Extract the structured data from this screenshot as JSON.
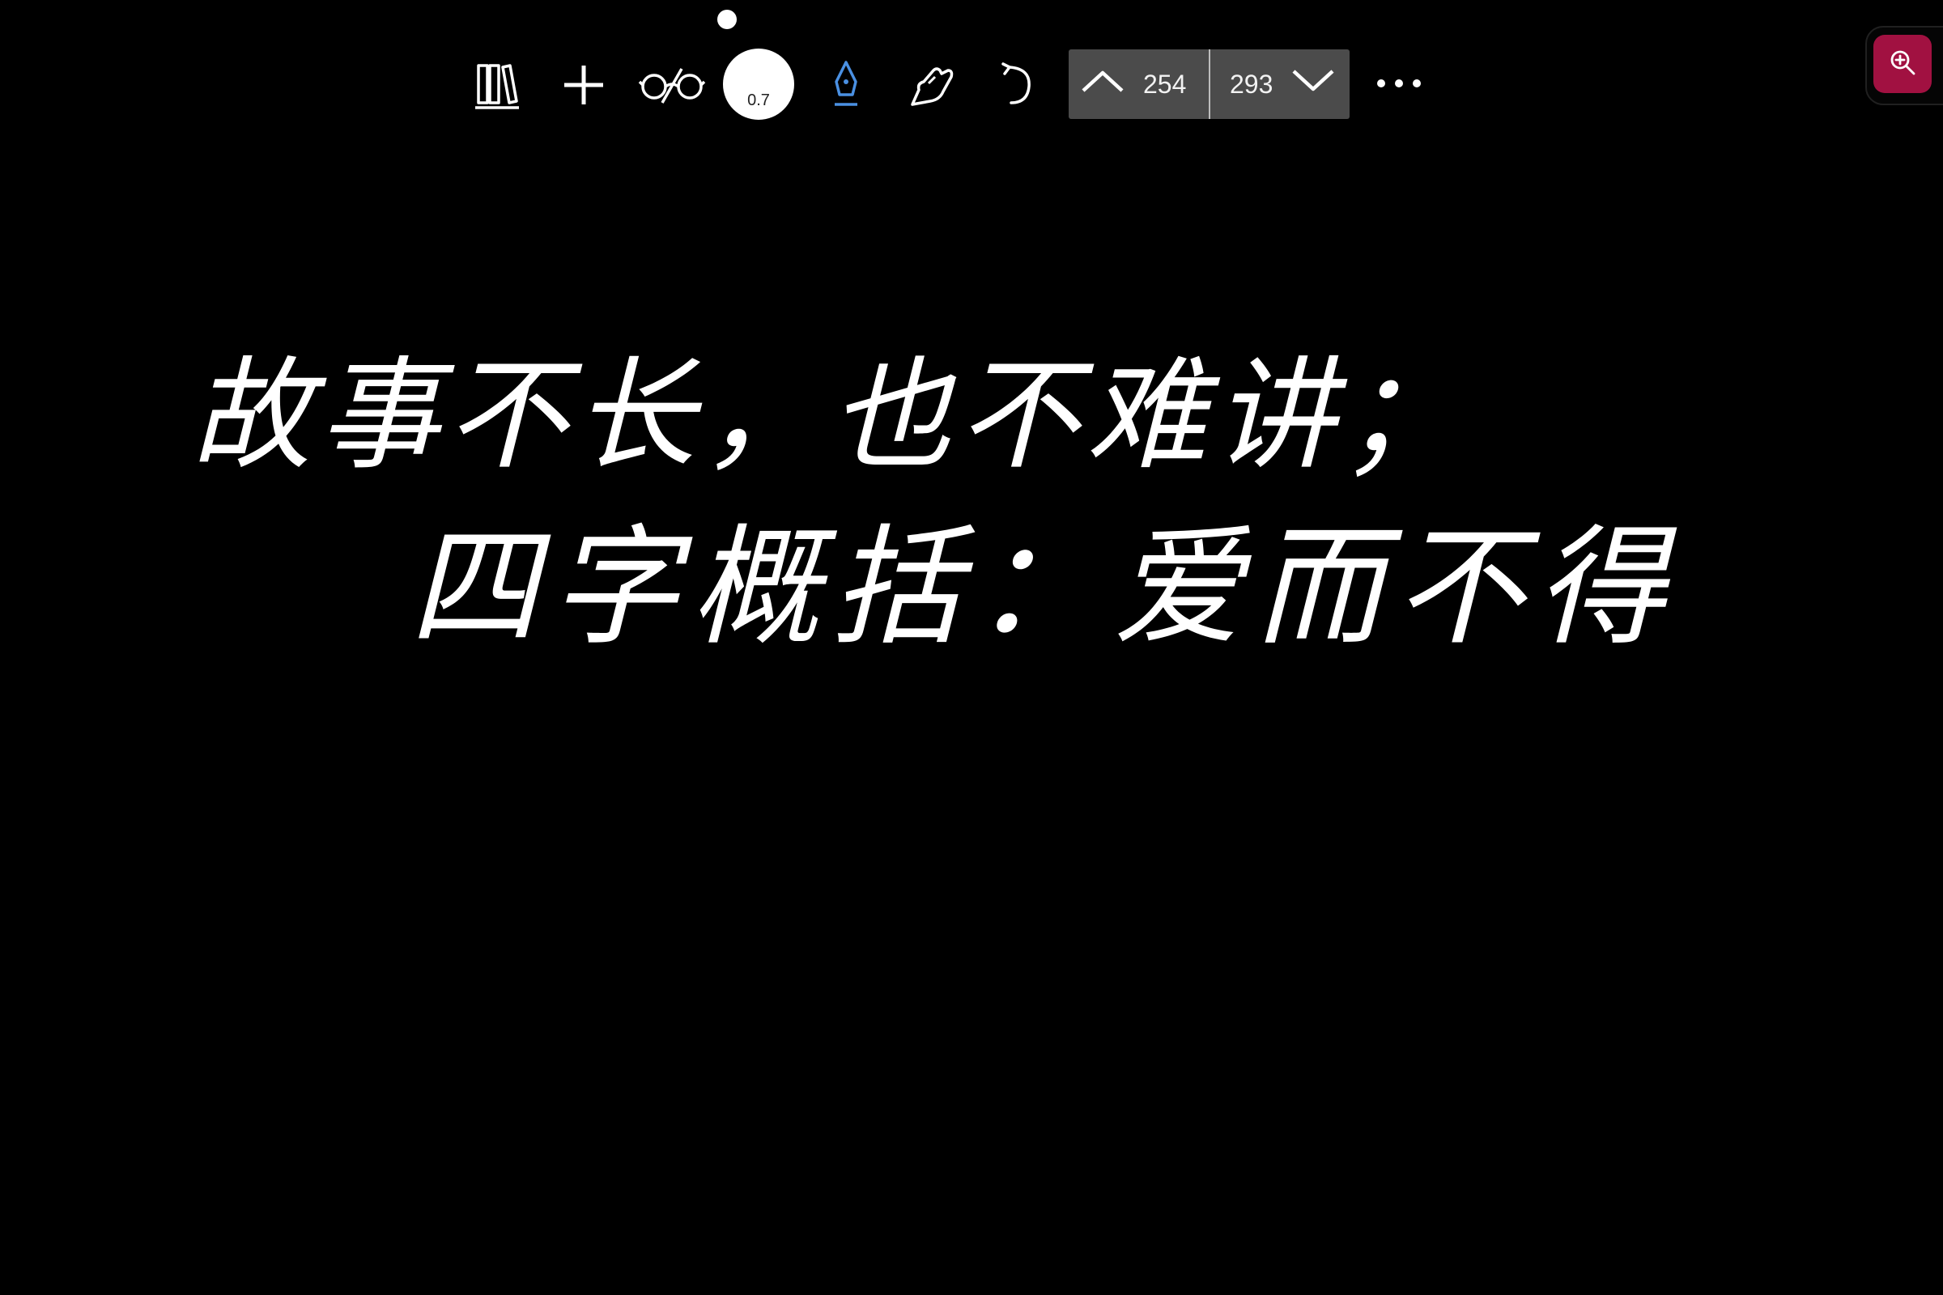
{
  "toolbar": {
    "icons": {
      "library": "library-books-icon",
      "add": "plus-icon",
      "view": "glasses-icon",
      "pen": "fountain-pen-icon",
      "pan": "hand-pointer-icon",
      "undo": "undo-icon",
      "more": "more-horizontal-icon",
      "prev": "chevron-up-icon",
      "next": "chevron-down-icon",
      "zoom": "zoom-in-icon"
    },
    "pen_size": "0.7",
    "page_nav": {
      "prev_page": "254",
      "next_page": "293"
    }
  },
  "canvas": {
    "handwriting_lines": [
      "故事不长，也不难讲；",
      "四字概括：爱而不得"
    ]
  },
  "colors": {
    "background": "#000000",
    "ink": "#ffffff",
    "pen_active": "#4a90e2",
    "page_nav_bg": "#4b4b4b",
    "zoom_button": "#a11141"
  }
}
